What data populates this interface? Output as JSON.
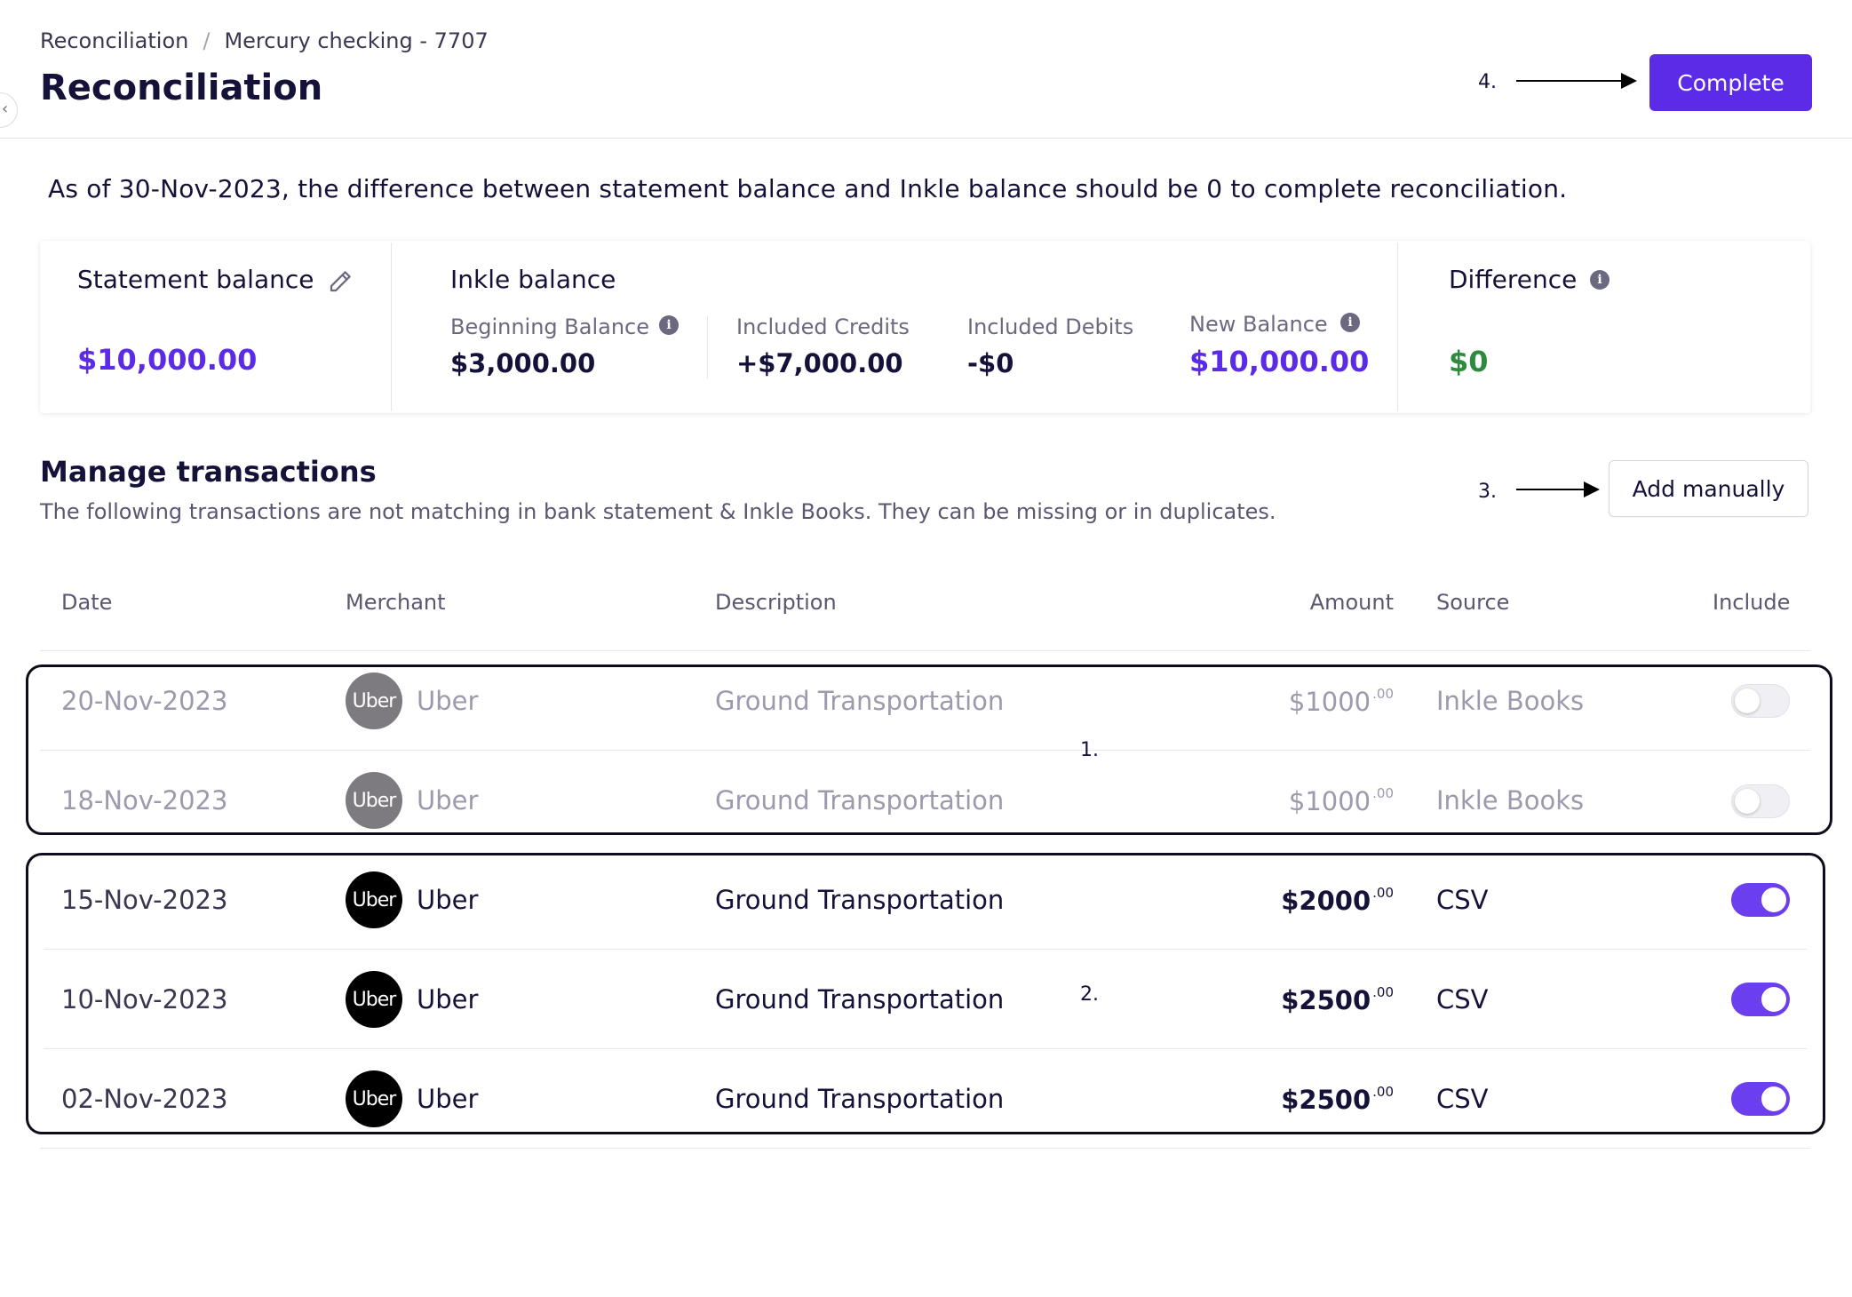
{
  "breadcrumb": {
    "root": "Reconciliation",
    "separator": "/",
    "current": "Mercury checking - 7707"
  },
  "page_title": "Reconciliation",
  "actions": {
    "complete_label": "Complete",
    "add_manually_label": "Add manually"
  },
  "annotations": {
    "one": "1.",
    "two": "2.",
    "three": "3.",
    "four": "4."
  },
  "note": "As of 30-Nov-2023, the difference between statement balance and Inkle balance should be 0 to complete reconciliation.",
  "balances": {
    "statement": {
      "label": "Statement balance",
      "value": "$10,000.00",
      "icon": "pencil-icon"
    },
    "inkle": {
      "label": "Inkle balance",
      "beginning_label": "Beginning Balance",
      "beginning_value": "$3,000.00",
      "credits_label": "Included Credits",
      "credits_value": "+$7,000.00",
      "debits_label": "Included Debits",
      "debits_value": "-$0",
      "new_label": "New Balance",
      "new_value": "$10,000.00"
    },
    "difference": {
      "label": "Difference",
      "value": "$0"
    }
  },
  "manage": {
    "title": "Manage transactions",
    "subtitle": "The following transactions are not matching in bank statement & Inkle Books. They can be missing or in duplicates."
  },
  "table": {
    "headers": {
      "date": "Date",
      "merchant": "Merchant",
      "description": "Description",
      "amount": "Amount",
      "source": "Source",
      "include": "Include"
    },
    "rows": [
      {
        "date": "20-Nov-2023",
        "logo": "Uber",
        "merchant": "Uber",
        "description": "Ground Transportation",
        "amount": "$1000",
        "cents": ".00",
        "source": "Inkle Books",
        "include": false
      },
      {
        "date": "18-Nov-2023",
        "logo": "Uber",
        "merchant": "Uber",
        "description": "Ground Transportation",
        "amount": "$1000",
        "cents": ".00",
        "source": "Inkle Books",
        "include": false
      },
      {
        "date": "15-Nov-2023",
        "logo": "Uber",
        "merchant": "Uber",
        "description": "Ground Transportation",
        "amount": "$2000",
        "cents": ".00",
        "source": "CSV",
        "include": true
      },
      {
        "date": "10-Nov-2023",
        "logo": "Uber",
        "merchant": "Uber",
        "description": "Ground Transportation",
        "amount": "$2500",
        "cents": ".00",
        "source": "CSV",
        "include": true
      },
      {
        "date": "02-Nov-2023",
        "logo": "Uber",
        "merchant": "Uber",
        "description": "Ground Transportation",
        "amount": "$2500",
        "cents": ".00",
        "source": "CSV",
        "include": true
      }
    ]
  },
  "colors": {
    "accent": "#5b2be6",
    "toggle_on": "#6b3ef0",
    "positive": "#2e8b3e",
    "text": "#15123a"
  }
}
